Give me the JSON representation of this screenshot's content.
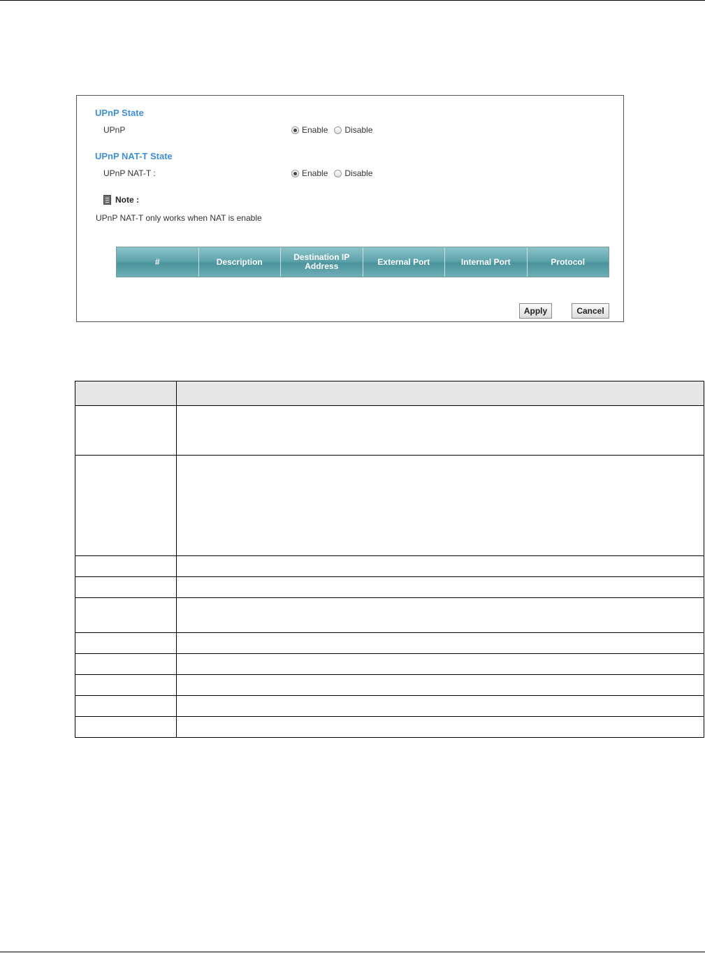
{
  "upnp_state": {
    "title": "UPnP State",
    "label": "UPnP",
    "options": [
      "Enable",
      "Disable"
    ],
    "selected": "Enable"
  },
  "nat_t_state": {
    "title": "UPnP NAT-T State",
    "label": "UPnP NAT-T :",
    "options": [
      "Enable",
      "Disable"
    ],
    "selected": "Enable"
  },
  "note": {
    "title": "Note :",
    "text": "UPnP NAT-T only works when NAT is enable"
  },
  "port_table": {
    "columns": [
      "#",
      "Description",
      "Destination IP Address",
      "External Port",
      "Internal Port",
      "Protocol"
    ]
  },
  "buttons": {
    "apply": "Apply",
    "cancel": "Cancel"
  }
}
